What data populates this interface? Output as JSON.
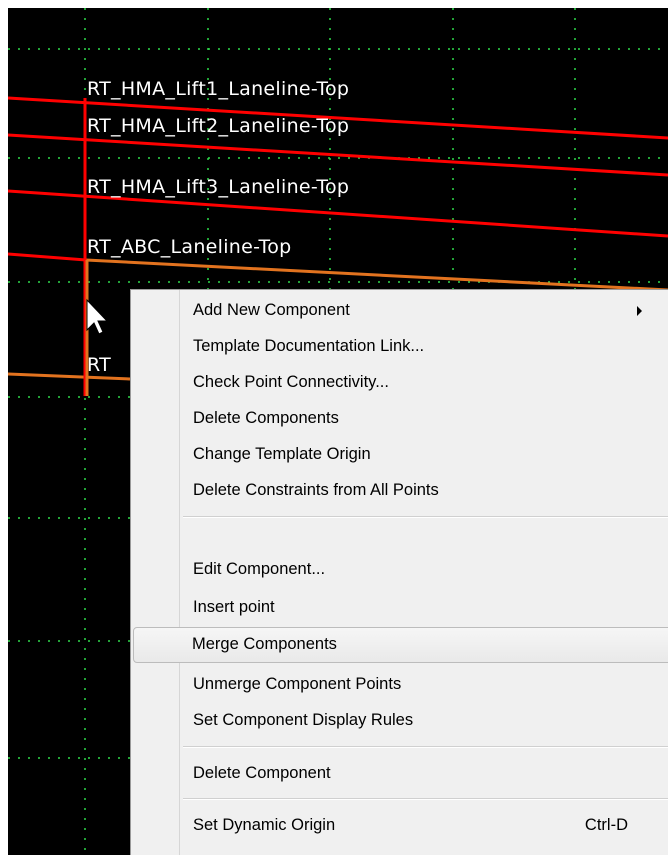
{
  "canvas": {
    "background": "#000000",
    "grid_color": "#2fd94a",
    "line_color_red": "#ff0000",
    "line_color_orange": "#e2731f",
    "labels": [
      "RT_HMA_Lift1_Laneline-Top",
      "RT_HMA_Lift2_Laneline-Top",
      "RT_HMA_Lift3_Laneline-Top",
      "RT_ABC_Laneline-Top",
      "RT"
    ]
  },
  "context_menu": {
    "items": [
      {
        "label": "Add New Component",
        "submenu": true
      },
      {
        "label": "Template Documentation Link..."
      },
      {
        "label": "Check Point Connectivity..."
      },
      {
        "label": "Delete Components"
      },
      {
        "label": "Change Template Origin"
      },
      {
        "label": "Delete Constraints from All Points"
      },
      {
        "label": "Edit Component..."
      },
      {
        "label": "Insert point"
      },
      {
        "label": "Merge Components",
        "highlighted": true
      },
      {
        "label": "Unmerge Component Points"
      },
      {
        "label": "Set Component Display Rules"
      },
      {
        "label": "Delete Component"
      },
      {
        "label": "Set Dynamic Origin",
        "shortcut": "Ctrl-D"
      }
    ]
  }
}
